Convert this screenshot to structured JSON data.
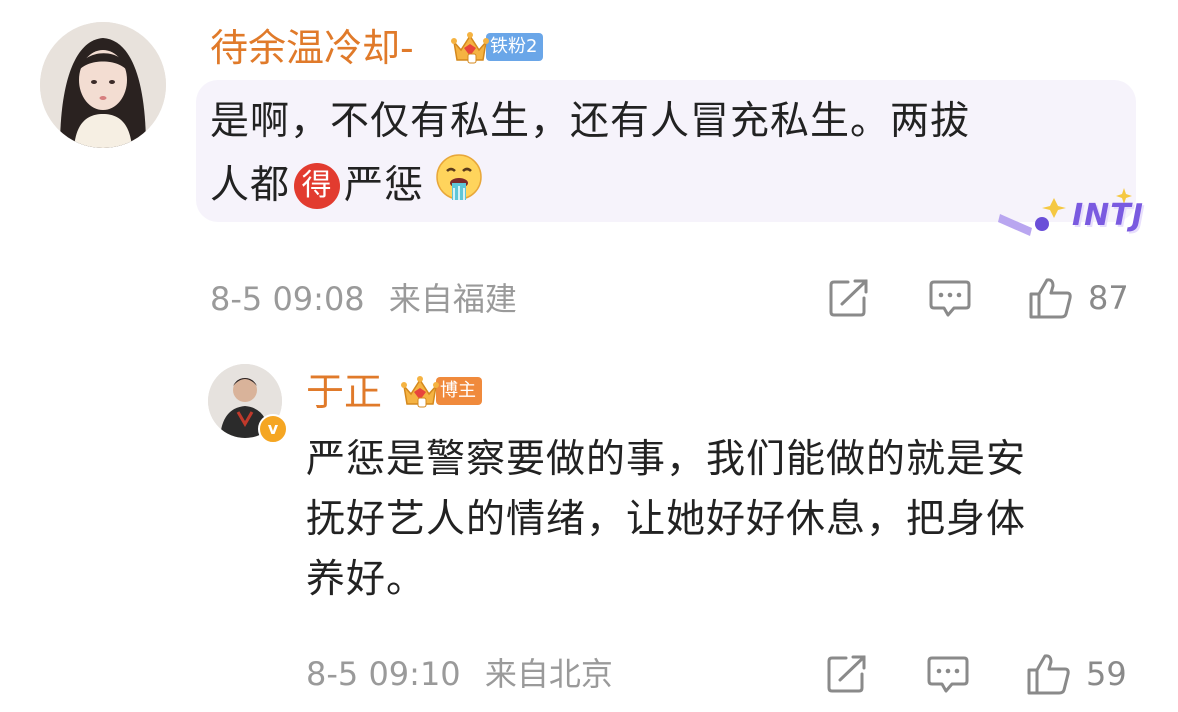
{
  "comments": [
    {
      "username": "待余温冷却-",
      "badge_label": "铁粉2",
      "text_line1": "是啊，不仅有私生，还有人冒充私生。两拔",
      "text_line2_a": "人都",
      "text_line2_emoji": "得",
      "text_line2_b": "严惩",
      "sticker_text": "INTJ",
      "timestamp": "8-5 09:08",
      "location": "来自福建",
      "like_count": "87"
    },
    {
      "username": "于正",
      "badge_label": "博主",
      "verified_mark": "v",
      "text_line1": "严惩是警察要做的事，我们能做的就是安",
      "text_line2": "抚好艺人的情绪，让她好好休息，把身体",
      "text_line3": "养好。",
      "timestamp": "8-5 09:10",
      "location": "来自北京",
      "like_count": "59"
    }
  ],
  "icons": {
    "share": "share-icon",
    "comment": "comment-icon",
    "like": "like-icon"
  },
  "colors": {
    "username": "#e07a2a",
    "badge_fan": "#6aa6e8",
    "badge_owner": "#f08a3c",
    "bubble": "#f6f3fb",
    "verified": "#f5a623"
  }
}
